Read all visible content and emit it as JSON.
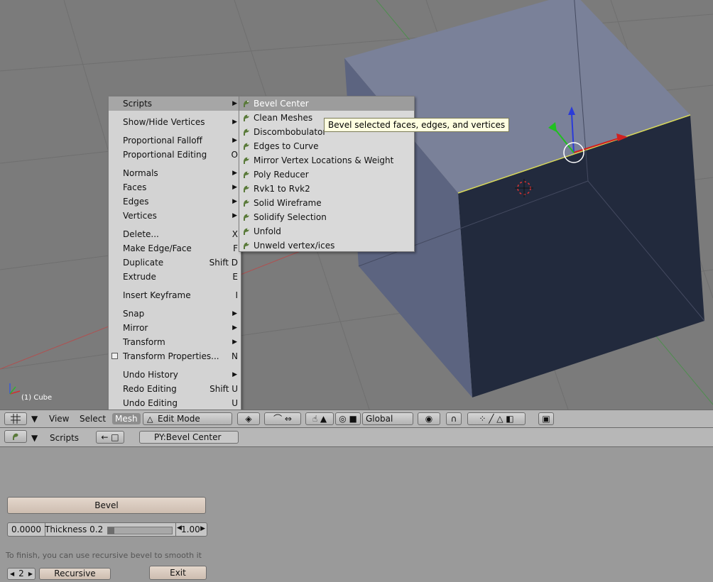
{
  "viewport": {
    "object_label": "(1) Cube"
  },
  "mesh_menu": {
    "items": [
      {
        "label": "Scripts",
        "shortcut": "",
        "submenu": true
      },
      {
        "label": "Show/Hide Vertices",
        "shortcut": "",
        "submenu": true
      },
      {
        "label": "Proportional Falloff",
        "shortcut": "",
        "submenu": true
      },
      {
        "label": "Proportional Editing",
        "shortcut": "O",
        "submenu": false
      },
      {
        "label": "Normals",
        "shortcut": "",
        "submenu": true
      },
      {
        "label": "Faces",
        "shortcut": "",
        "submenu": true
      },
      {
        "label": "Edges",
        "shortcut": "",
        "submenu": true
      },
      {
        "label": "Vertices",
        "shortcut": "",
        "submenu": true
      },
      {
        "label": "Delete...",
        "shortcut": "X",
        "submenu": false
      },
      {
        "label": "Make Edge/Face",
        "shortcut": "F",
        "submenu": false
      },
      {
        "label": "Duplicate",
        "shortcut": "Shift D",
        "submenu": false
      },
      {
        "label": "Extrude",
        "shortcut": "E",
        "submenu": false
      },
      {
        "label": "Insert Keyframe",
        "shortcut": "I",
        "submenu": false
      },
      {
        "label": "Snap",
        "shortcut": "",
        "submenu": true
      },
      {
        "label": "Mirror",
        "shortcut": "",
        "submenu": true
      },
      {
        "label": "Transform",
        "shortcut": "",
        "submenu": true
      },
      {
        "label": "Transform Properties...",
        "shortcut": "N",
        "submenu": false
      },
      {
        "label": "Undo History",
        "shortcut": "",
        "submenu": true
      },
      {
        "label": "Redo Editing",
        "shortcut": "Shift U",
        "submenu": false
      },
      {
        "label": "Undo Editing",
        "shortcut": "U",
        "submenu": false
      }
    ]
  },
  "scripts_menu": {
    "items": [
      "Bevel Center",
      "Clean Meshes",
      "Discombobulator",
      "Edges to Curve",
      "Mirror Vertex Locations & Weight",
      "Poly Reducer",
      "Rvk1 to Rvk2",
      "Solid Wireframe",
      "Solidify Selection",
      "Unfold",
      "Unweld vertex/ices"
    ],
    "icon": "python-icon"
  },
  "tooltip": "Bevel selected faces, edges, and vertices",
  "header3d": {
    "view": "View",
    "select": "Select",
    "mesh": "Mesh",
    "mode": "Edit Mode",
    "orientation": "Global"
  },
  "header_scripts": {
    "label": "Scripts",
    "script_name": "PY:Bevel Center"
  },
  "panel": {
    "bevel_label": "Bevel",
    "min_value": "0.0000",
    "thickness_label": "Thickness  0.2",
    "max_value": "1.00",
    "hint": "To finish, you can use recursive bevel to smooth it",
    "recursive_count": "2",
    "recursive_label": "Recursive",
    "exit_label": "Exit",
    "thickness_fraction": 0.1
  },
  "colors": {
    "viewport_bg": "#7b7b7b",
    "cube_top": "#7a8199",
    "cube_front": "#222a3d",
    "cube_side": "#5c6480"
  }
}
